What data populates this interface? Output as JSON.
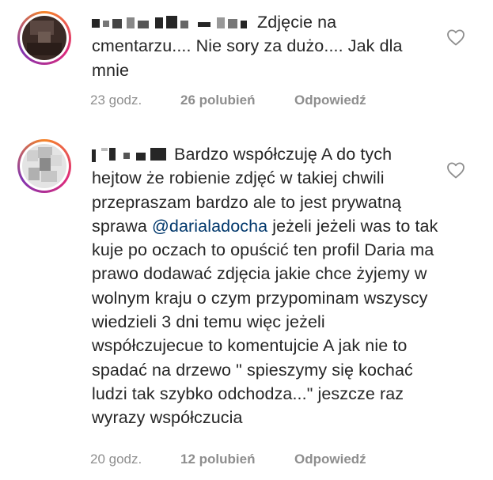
{
  "comments": [
    {
      "username": "e_j_a_l_a",
      "text": "Zdjęcie na cmentarzu.... Nie sory za dużo.... Jak dla mnie",
      "time": "23 godz.",
      "likes": "26 polubień",
      "reply": "Odpowiedź"
    },
    {
      "username": "j_l_k_a",
      "text_a": "Bardzo współczuję A do tych hejtow że robienie zdjęć w takiej chwili przepraszam bardzo ale to jest prywatną sprawa ",
      "mention": "@darialadocha",
      "text_b": " jeżeli jeżeli was to tak kuje po oczach to opuścić ten profil Daria ma prawo dodawać zdjęcia jakie chce żyjemy w wolnym kraju o czym przypominam wszyscy wiedzieli 3 dni temu więc jeżeli współczujecue to komentujcie A jak nie to spadać na drzewo \" spieszymy się kochać ludzi tak szybko odchodza...\" jeszcze raz wyrazy współczucia",
      "time": "20 godz.",
      "likes": "12 polubień",
      "reply": "Odpowiedź"
    }
  ],
  "icons": {
    "like": "heart-outline-icon"
  },
  "colors": {
    "text": "#262626",
    "meta": "#8e8e8e",
    "mention": "#00376b"
  }
}
